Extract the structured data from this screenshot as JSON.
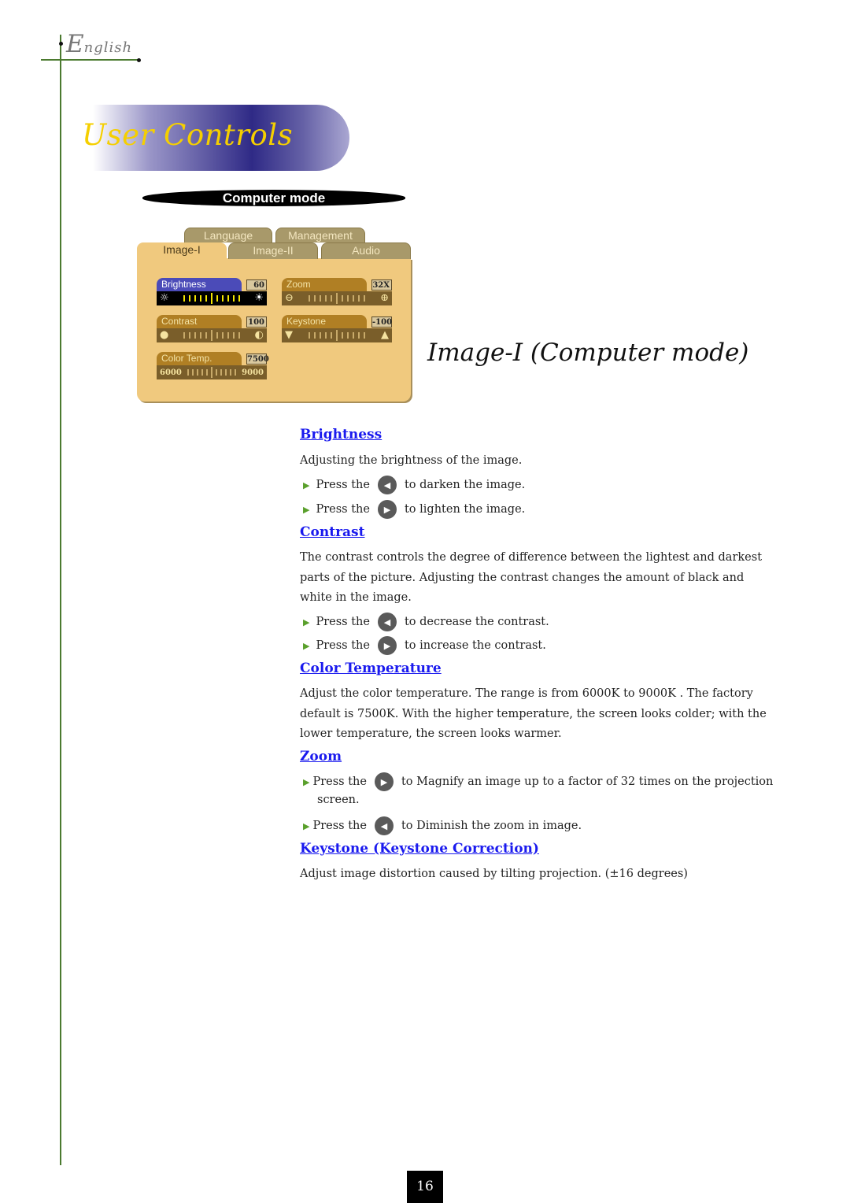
{
  "header": {
    "language_initial": "E",
    "language_rest": "nglish",
    "section_title": "User Controls"
  },
  "osd": {
    "mode_label": "Computer mode",
    "tabs_back": [
      "Language",
      "Management"
    ],
    "tabs_front": [
      "Image-I",
      "Image-II",
      "Audio"
    ],
    "active_tab": "Image-I",
    "controls": {
      "brightness": {
        "label": "Brightness",
        "value": "60",
        "left_icon": "☼",
        "right_icon": "☀"
      },
      "contrast": {
        "label": "Contrast",
        "value": "100",
        "left_icon": "●",
        "right_icon": "◐"
      },
      "color_temp": {
        "label": "Color Temp.",
        "value": "7500",
        "min": "6000",
        "max": "9000"
      },
      "zoom": {
        "label": "Zoom",
        "value": "32X",
        "left_icon": "⊖",
        "right_icon": "⊕"
      },
      "keystone": {
        "label": "Keystone",
        "value": "-100",
        "left_icon": "▼",
        "right_icon": "▲"
      }
    },
    "colors": {
      "panel": "#f0c97e",
      "active_label": "#4b4bb8",
      "inactive_label": "#b07f24"
    }
  },
  "page_heading": "Image-I (Computer mode)",
  "sections": {
    "brightness": {
      "title": "Brightness",
      "text": "Adjusting the brightness of the image.",
      "bullets": [
        {
          "prefix": "Press the",
          "button": "left",
          "suffix": "to darken the image."
        },
        {
          "prefix": "Press the",
          "button": "right",
          "suffix": "to lighten the image."
        }
      ]
    },
    "contrast": {
      "title": "Contrast",
      "text": "The contrast controls the degree of difference between the lightest and darkest parts of  the picture. Adjusting  the contrast changes the amount of black and white in the image.",
      "bullets": [
        {
          "prefix": "Press the",
          "button": "left",
          "suffix": "to decrease the contrast."
        },
        {
          "prefix": "Press the",
          "button": "right",
          "suffix": "to increase the contrast."
        }
      ]
    },
    "color_temperature": {
      "title": "Color Temperature",
      "text": "Adjust the color temperature. The range is from 6000K to 9000K . The factory default is 7500K.  With the higher temperature, the screen looks colder; with the lower temperature, the screen looks warmer."
    },
    "zoom": {
      "title": "Zoom",
      "bullets": [
        {
          "prefix": "Press the",
          "button": "right",
          "suffix": "to Magnify an image up to a factor of 32 times on the projection",
          "continuation": "screen."
        },
        {
          "prefix": "Press the",
          "button": "left",
          "suffix": "to Diminish the zoom in image."
        }
      ]
    },
    "keystone": {
      "title": "Keystone (Keystone Correction)",
      "text": "Adjust image distortion caused by tilting projection. (±16 degrees)"
    }
  },
  "footer": {
    "page_number": "16"
  },
  "colors": {
    "link": "#1a1aee",
    "title": "#f5cf00",
    "rule": "#4b7a2f"
  }
}
